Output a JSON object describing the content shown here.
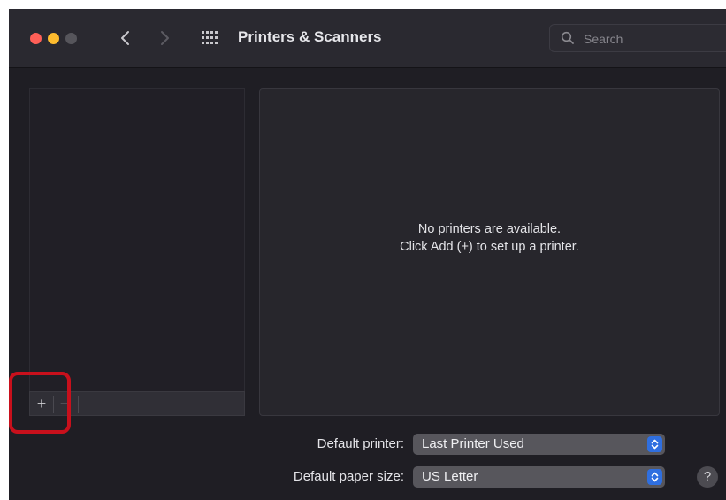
{
  "window": {
    "title": "Printers & Scanners",
    "traffic_lights": {
      "close_color": "#fe5f57",
      "minimize_color": "#febc2e",
      "zoom_color": "#56555b"
    }
  },
  "toolbar": {
    "back_icon": "chevron-left-icon",
    "forward_icon": "chevron-right-icon",
    "grid_icon": "show-all-grid-icon",
    "search_placeholder": "Search"
  },
  "printer_list": {
    "items": [],
    "add_label": "+",
    "remove_label": "−",
    "highlight_color": "#c8101c"
  },
  "detail": {
    "empty_line1": "No printers are available.",
    "empty_line2": "Click Add (+) to set up a printer."
  },
  "settings": {
    "default_printer_label": "Default printer:",
    "default_printer_value": "Last Printer Used",
    "default_paper_label": "Default paper size:",
    "default_paper_value": "US Letter",
    "accent_color": "#2f6fe0"
  },
  "help": {
    "label": "?"
  }
}
